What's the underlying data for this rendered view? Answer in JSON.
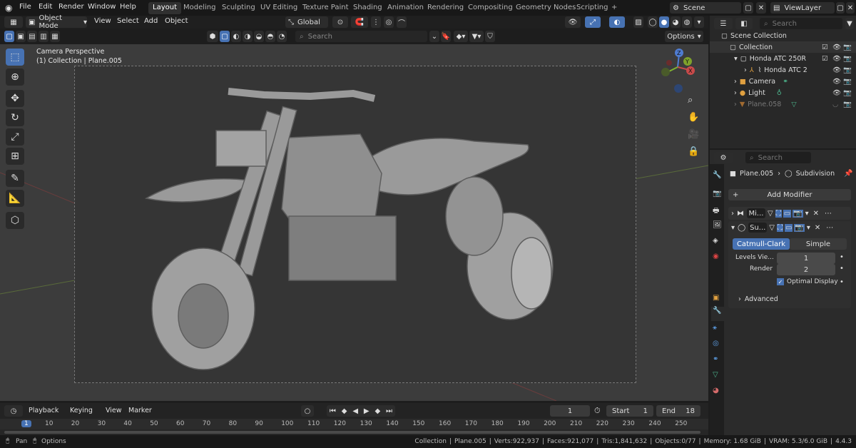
{
  "menu": {
    "file": "File",
    "edit": "Edit",
    "render": "Render",
    "window": "Window",
    "help": "Help"
  },
  "workspaces": [
    "Layout",
    "Modeling",
    "Sculpting",
    "UV Editing",
    "Texture Paint",
    "Shading",
    "Animation",
    "Rendering",
    "Compositing",
    "Geometry Nodes",
    "Scripting",
    "+"
  ],
  "active_workspace": "Layout",
  "scene": {
    "label": "Scene",
    "view_layer": "ViewLayer"
  },
  "viewport_header": {
    "mode": "Object Mode",
    "view": "View",
    "select": "Select",
    "add": "Add",
    "object": "Object",
    "transform_orientation": "Global",
    "search_placeholder": "Search",
    "options": "Options"
  },
  "viewport_overlay": {
    "line1": "Camera Perspective",
    "line2": "(1) Collection | Plane.005"
  },
  "gizmo": {
    "z": "Z",
    "y": "Y",
    "x": "X"
  },
  "outliner": {
    "search_placeholder": "Search",
    "rows": [
      {
        "label": "Scene Collection"
      },
      {
        "label": "Collection"
      },
      {
        "label": "Honda ATC 250R"
      },
      {
        "label": "Honda ATC 2"
      },
      {
        "label": "Camera"
      },
      {
        "label": "Light"
      },
      {
        "label": "Plane.058"
      }
    ]
  },
  "properties": {
    "search_placeholder": "Search",
    "object": "Plane.005",
    "modifier_context": "Subdivision",
    "add_modifier": "Add Modifier",
    "modifiers": [
      {
        "name": "Mi..."
      },
      {
        "name": "Su..."
      }
    ],
    "subdiv": {
      "catmull": "Catmull-Clark",
      "simple": "Simple",
      "levels_label": "Levels Vie...",
      "levels_value": "1",
      "render_label": "Render",
      "render_value": "2",
      "optimal": "Optimal Display",
      "advanced": "Advanced"
    }
  },
  "timeline": {
    "playback": "Playback",
    "keying": "Keying",
    "view": "View",
    "marker": "Marker",
    "current_frame": "1",
    "start_label": "Start",
    "start_value": "1",
    "end_label": "End",
    "end_value": "18",
    "ticks": [
      "1",
      "10",
      "20",
      "30",
      "40",
      "50",
      "60",
      "70",
      "80",
      "90",
      "100",
      "110",
      "120",
      "130",
      "140",
      "150",
      "160",
      "170",
      "180",
      "190",
      "200",
      "210",
      "220",
      "230",
      "240",
      "250"
    ]
  },
  "statusbar": {
    "pan": "Pan",
    "options": "Options",
    "collection": "Collection",
    "object": "Plane.005",
    "verts": "Verts:922,937",
    "faces": "Faces:921,077",
    "tris": "Tris:1,841,632",
    "objects": "Objects:0/77",
    "memory": "Memory: 1.68 GiB",
    "vram": "VRAM: 5.3/6.0 GiB",
    "version": "4.4.3"
  },
  "colors": {
    "accent": "#4772b3",
    "bg": "#1d1d1d",
    "viewport": "#3c3c3c"
  }
}
